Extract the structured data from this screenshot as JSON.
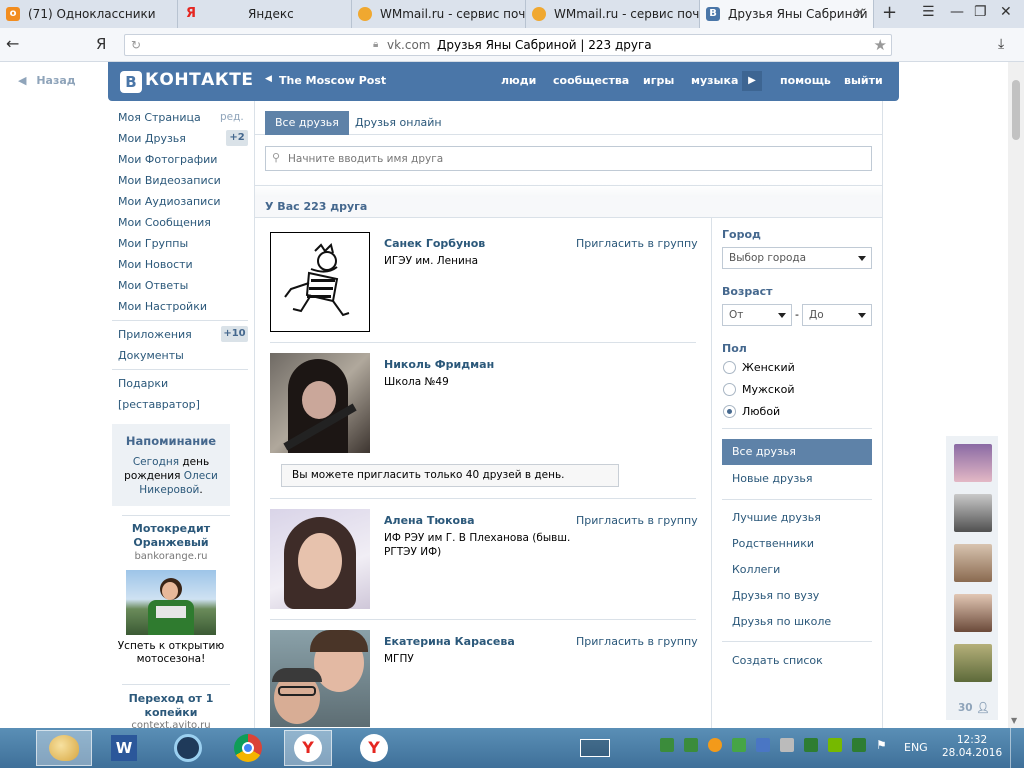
{
  "browser": {
    "tabs": [
      {
        "title": "(71) Одноклассники",
        "icon_color": "#f28d1f",
        "icon_glyph": "о"
      },
      {
        "title": "Яндекс",
        "icon_color": "#e52620",
        "icon_glyph": "Я"
      },
      {
        "title": "WMmail.ru - сервис почто",
        "icon_color": "#f0a830",
        "icon_glyph": "W"
      },
      {
        "title": "WMmail.ru - сервис почто",
        "icon_color": "#f0a830",
        "icon_glyph": "W"
      },
      {
        "title": "Друзья Яны Сабриной",
        "icon_color": "#4a76a8",
        "icon_glyph": "В"
      }
    ],
    "back_label": "Назад",
    "url_domain": "vk.com",
    "url_title": "Друзья Яны Сабриной | 223 друга",
    "yandex_glyph": "Я"
  },
  "vk_header": {
    "logo_badge": "В",
    "logo_text": "КОНТАКТЕ",
    "moscow_post": "The Moscow Post",
    "nav": [
      "люди",
      "сообщества",
      "игры",
      "музыка",
      "помощь",
      "выйти"
    ]
  },
  "left_menu": {
    "items": [
      {
        "label": "Моя Страница",
        "extra": "ред."
      },
      {
        "label": "Мои Друзья",
        "count": "+2"
      },
      {
        "label": "Мои Фотографии"
      },
      {
        "label": "Мои Видеозаписи"
      },
      {
        "label": "Мои Аудиозаписи"
      },
      {
        "label": "Мои Сообщения"
      },
      {
        "label": "Мои Группы"
      },
      {
        "label": "Мои Новости"
      },
      {
        "label": "Мои Ответы"
      },
      {
        "label": "Мои Настройки"
      }
    ],
    "apps": [
      {
        "label": "Приложения",
        "count": "+10"
      },
      {
        "label": "Документы"
      }
    ],
    "extra": [
      {
        "label": "Подарки"
      },
      {
        "label": "[реставратор]"
      }
    ],
    "reminder": {
      "title": "Напоминание",
      "text1": "Сегодня",
      "text2": "день",
      "text3": "рождения",
      "name1": "Олеси",
      "name2": "Никеровой"
    },
    "ad1": {
      "title1": "Мотокредит",
      "title2": "Оранжевый",
      "domain": "bankorange.ru",
      "text1": "Успеть к открытию",
      "text2": "мотосезона!"
    },
    "ad2": {
      "title1": "Переход от 1",
      "title2": "копейки",
      "domain": "context.avito.ru"
    }
  },
  "content": {
    "tab_all": "Все друзья",
    "tab_online": "Друзья онлайн",
    "search_placeholder": "Начните вводить имя друга",
    "count_text": "У Вас 223 друга",
    "invite_notice": "Вы можете пригласить только 40 друзей в день.",
    "friends": [
      {
        "name": "Санек Горбунов",
        "sub": "ИГЭУ им. Ленина",
        "invite": "Пригласить в группу"
      },
      {
        "name": "Николь Фридман",
        "sub": "Школа №49",
        "invite": ""
      },
      {
        "name": "Алена Тюкова",
        "sub1": "ИФ РЭУ им Г. В Плеханова (бывш.",
        "sub2": "РГТЭУ ИФ)",
        "invite": "Пригласить в группу"
      },
      {
        "name": "Екатерина Карасева",
        "sub": "МГПУ",
        "invite": "Пригласить в группу"
      }
    ]
  },
  "right_panel": {
    "city_label": "Город",
    "city_select": "Выбор города",
    "age_label": "Возраст",
    "age_from": "От",
    "age_to": "До",
    "age_dash": "-",
    "gender_label": "Пол",
    "genders": [
      "Женский",
      "Мужской",
      "Любой"
    ],
    "gender_selected": "Любой",
    "lists": [
      "Все друзья",
      "Новые друзья"
    ],
    "lists2": [
      "Лучшие друзья",
      "Родственники",
      "Коллеги",
      "Друзья по вузу",
      "Друзья по школе"
    ],
    "create_list": "Создать список"
  },
  "online_sidebar": {
    "count": "30"
  },
  "taskbar": {
    "lang": "ENG",
    "time": "12:32",
    "date": "28.04.2016"
  }
}
